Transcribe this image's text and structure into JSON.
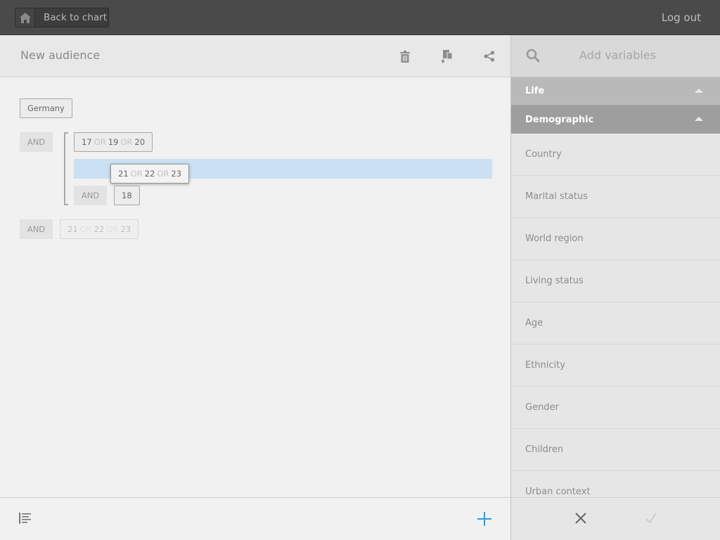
{
  "topbar": {
    "back_label": "Back to chart",
    "logout_label": "Log out",
    "home_icon": "home-icon"
  },
  "audience": {
    "title": "New audience",
    "icons": [
      "trash-icon",
      "export-icon",
      "share-icon"
    ]
  },
  "builder": {
    "root_tag": "Germany",
    "groups": [
      {
        "operator": "AND",
        "values": [
          "17",
          "19",
          "20"
        ]
      },
      {
        "dragging_values": [
          "21",
          "22",
          "23"
        ]
      },
      {
        "operator": "AND",
        "values": [
          "18"
        ]
      },
      {
        "operator": "AND",
        "ghost_values": [
          "21",
          "22",
          "23"
        ]
      }
    ],
    "or_label": "OR",
    "and_label": "AND"
  },
  "right_panel": {
    "title": "Add variables",
    "search_icon": "search-icon",
    "categories": [
      {
        "label": "Life"
      },
      {
        "label": "Demographic"
      }
    ],
    "variables": [
      "Country",
      "Marital status",
      "World region",
      "Living status",
      "Age",
      "Ethnicity",
      "Gender",
      "Children",
      "Urban context"
    ]
  },
  "colors": {
    "accent_blue": "#2a9fe0",
    "drop_zone": "#cbe1f3",
    "topbar": "#4a4a4a"
  }
}
